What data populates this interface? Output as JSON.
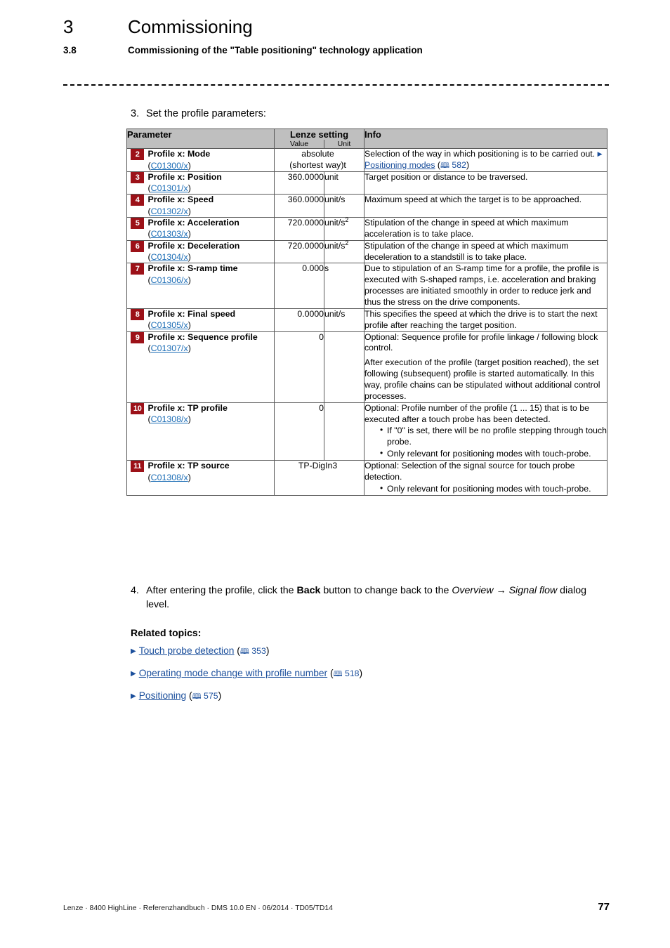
{
  "header": {
    "chapter_number": "3",
    "chapter_title": "Commissioning",
    "section_number": "3.8",
    "section_title": "Commissioning of the \"Table positioning\" technology application"
  },
  "step3": {
    "number": "3.",
    "text": "Set the profile parameters:"
  },
  "table": {
    "headers": {
      "parameter": "Parameter",
      "lenze_setting": "Lenze setting",
      "value": "Value",
      "unit": "Unit",
      "info": "Info"
    },
    "rows": [
      {
        "badge": "2",
        "name": "Profile x: Mode",
        "code": "C01300/x",
        "value": "absolute\n(shortest way)t",
        "value_spans_unit": true,
        "unit": "",
        "info_lead": "Selection of the way in which positioning is to be carried out.",
        "info_link": "Positioning modes",
        "info_page": "582",
        "info_paras": [],
        "bullets": []
      },
      {
        "badge": "3",
        "name": "Profile x: Position",
        "code": "C01301/x",
        "value": "360.0000",
        "unit": "unit",
        "info_paras": [
          "Target position or distance to be traversed."
        ],
        "bullets": []
      },
      {
        "badge": "4",
        "name": "Profile x: Speed",
        "code": "C01302/x",
        "value": "360.0000",
        "unit": "unit/s",
        "info_paras": [
          "Maximum speed at which the target is to be approached."
        ],
        "bullets": []
      },
      {
        "badge": "5",
        "name": "Profile x: Acceleration",
        "code": "C01303/x",
        "value": "720.0000",
        "unit": "unit/s",
        "unit_sup": "2",
        "info_paras": [
          "Stipulation of the change in speed at which maximum acceleration is to take place."
        ],
        "bullets": []
      },
      {
        "badge": "6",
        "name": "Profile x: Deceleration",
        "code": "C01304/x",
        "value": "720.0000",
        "unit": "unit/s",
        "unit_sup": "2",
        "info_paras": [
          "Stipulation of the change in speed at which maximum deceleration to a standstill is to take place."
        ],
        "bullets": []
      },
      {
        "badge": "7",
        "name": "Profile x: S-ramp time",
        "code": "C01306/x",
        "value": "0.000",
        "unit": "s",
        "info_paras": [
          "Due to stipulation of an S-ramp time for a profile, the profile is executed with S-shaped ramps, i.e. acceleration and braking processes are initiated smoothly in order to reduce jerk and thus the stress on the drive components."
        ],
        "bullets": []
      },
      {
        "badge": "8",
        "name": "Profile x: Final speed",
        "code": "C01305/x",
        "value": "0.0000",
        "unit": "unit/s",
        "info_paras": [
          "This specifies the speed at which the drive is to start the next profile after reaching the target position."
        ],
        "bullets": []
      },
      {
        "badge": "9",
        "name": "Profile x: Sequence profile",
        "code": "C01307/x",
        "value": "0",
        "unit": "",
        "info_paras": [
          "Optional: Sequence profile for profile linkage / following block control.",
          "After execution of the profile (target position reached), the set following (subsequent) profile is started automatically. In this way, profile chains can be stipulated without additional control processes."
        ],
        "bullets": []
      },
      {
        "badge": "10",
        "name": "Profile x: TP profile",
        "code": "C01308/x",
        "value": "0",
        "unit": "",
        "info_paras": [
          "Optional: Profile number of the profile (1 ... 15) that is to be executed after a touch probe has been detected."
        ],
        "bullets": [
          "If \"0\" is set, there will be no profile stepping through touch probe.",
          "Only relevant for positioning modes with touch-probe."
        ]
      },
      {
        "badge": "11",
        "name": "Profile x: TP source",
        "code": "C01308/x",
        "value": "TP-DigIn3",
        "value_spans_unit": true,
        "unit": "",
        "info_paras": [
          "Optional: Selection of the signal source for touch probe detection."
        ],
        "bullets": [
          "Only relevant for positioning modes with touch-probe."
        ]
      }
    ]
  },
  "step4": {
    "number": "4.",
    "part1": "After entering the profile, click the ",
    "bold1": "Back",
    "part2": " button to change back to the ",
    "italic1": "Overview",
    "arrow": " → ",
    "italic2": "Signal flow",
    "part3": " dialog level."
  },
  "related": {
    "heading": "Related topics:",
    "items": [
      {
        "label": "Touch probe detection",
        "page": "353"
      },
      {
        "label": "Operating mode change with profile number",
        "page": "518"
      },
      {
        "label": "Positioning",
        "page": "575"
      }
    ]
  },
  "footer": {
    "text": "Lenze · 8400 HighLine · Referenzhandbuch · DMS 10.0 EN · 06/2014 · TD05/TD14",
    "page_number": "77"
  },
  "colors": {
    "badge_bg": "#9c1118",
    "header_bg": "#bfbfbf",
    "link": "#1b4f9c"
  }
}
